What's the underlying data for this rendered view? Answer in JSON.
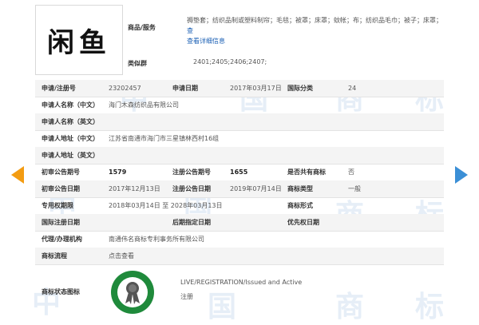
{
  "header": {
    "logo_text": "闲鱼",
    "goods_label": "商品/服务",
    "goods_value": "褥垫套；纺织品制或塑料制帘；毛毯；被罩；床罩；蚊帐；布；纺织品毛巾；被子；床罩；",
    "goods_more": "查看详细信息",
    "group_label": "类似群",
    "group_value": "2401;2405;2406;2407;"
  },
  "rows": {
    "apply_no_label": "申请/注册号",
    "apply_no_value": "23202457",
    "apply_date_label": "申请日期",
    "apply_date_value": "2017年03月17日",
    "class_label": "国际分类",
    "class_value": "24",
    "applicant_cn_label": "申请人名称（中文）",
    "applicant_cn_value": "海门木森纺织品有限公司",
    "applicant_en_label": "申请人名称（英文）",
    "address_cn_label": "申请人地址（中文）",
    "address_cn_value": "江苏省南通市海门市三星镇林西村16组",
    "address_en_label": "申请人地址（英文）",
    "first_pub_no_label": "初审公告期号",
    "first_pub_no_value": "1579",
    "reg_pub_no_label": "注册公告期号",
    "reg_pub_no_value": "1655",
    "shared_label": "是否共有商标",
    "shared_value": "否",
    "first_pub_date_label": "初审公告日期",
    "first_pub_date_value": "2017年12月13日",
    "reg_pub_date_label": "注册公告日期",
    "reg_pub_date_value": "2019年07月14日",
    "mark_type_label": "商标类型",
    "mark_type_value": "一般",
    "exclusive_label": "专用权期限",
    "exclusive_value": "2018年03月14日 至 2028年03月13日",
    "mark_form_label": "商标形式",
    "intl_reg_label": "国际注册日期",
    "later_date_label": "后期指定日期",
    "priority_label": "优先权日期",
    "agent_label": "代理/办理机构",
    "agent_value": "南通伟名商标专利事务所有限公司",
    "process_label": "商标流程",
    "process_value": "点击查看",
    "status_label": "商标状态图标",
    "status_en": "LIVE/REGISTRATION/Issued and Active",
    "status_cn": "注册"
  },
  "icons": {
    "prev": "left-arrow-icon",
    "next": "right-arrow-icon",
    "status": "ribbon-badge-icon"
  },
  "colors": {
    "link": "#1a5fb4",
    "prev_arrow": "#f39c12",
    "next_arrow": "#3b8fd6",
    "badge": "#1f8a3b",
    "watermark": "#e6eef7"
  },
  "watermark_text": [
    "中",
    "国",
    "商",
    "标",
    "中",
    "国",
    "商",
    "标",
    "中",
    "国",
    "商",
    "标"
  ]
}
